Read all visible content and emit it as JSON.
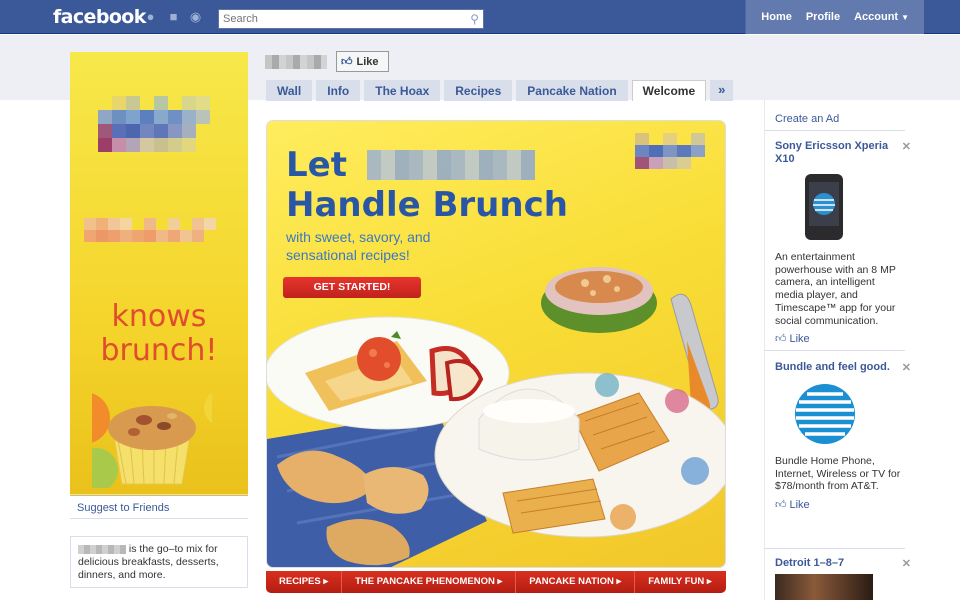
{
  "header": {
    "logo": "facebook",
    "search_placeholder": "Search",
    "nav": [
      "Home",
      "Profile",
      "Account"
    ]
  },
  "page": {
    "like_label": "Like",
    "tabs": [
      "Wall",
      "Info",
      "The Hoax",
      "Recipes",
      "Pancake Nation",
      "Welcome",
      "»"
    ],
    "active_tab": "Welcome"
  },
  "left_column": {
    "ad_text": "knows brunch!",
    "suggest_link": "Suggest to Friends",
    "info_text": "is the go–to mix for delicious breakfasts, desserts, dinners, and more."
  },
  "banner": {
    "headline_1": "Let",
    "headline_2": "Handle Brunch",
    "subhead_1": "with sweet, savory, and",
    "subhead_2": "sensational recipes!",
    "cta": "GET STARTED!",
    "nav": [
      "RECIPES ▸",
      "THE PANCAKE PHENOMENON ▸",
      "PANCAKE NATION ▸",
      "FAMILY FUN ▸"
    ]
  },
  "right_column": {
    "create_ad": "Create an Ad",
    "ads": [
      {
        "title": "Sony Ericsson Xperia X10",
        "body": "An entertainment powerhouse with an 8 MP camera, an intelligent media player, and Timescape™ app for your social communication.",
        "like": "Like"
      },
      {
        "title": "Bundle and feel good.",
        "body": "Bundle Home Phone, Internet, Wireless or TV for $78/month from AT&T.",
        "like": "Like"
      },
      {
        "title": "Detroit 1–8–7"
      }
    ]
  },
  "colors": {
    "facebook_blue": "#3b5998",
    "banner_yellow": "#f9dd36",
    "banner_blue": "#2a56a6",
    "cta_red": "#d9301f"
  }
}
